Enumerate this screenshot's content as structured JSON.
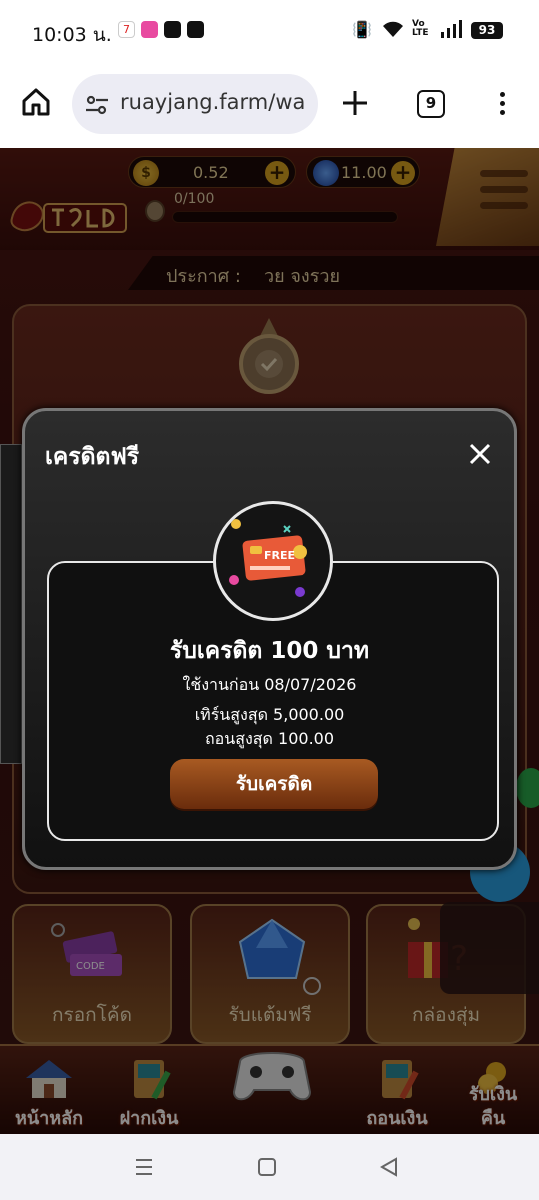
{
  "status_bar": {
    "time": "10:03 น.",
    "battery": "93"
  },
  "browser": {
    "url": "ruayjang.farm/wa",
    "tab_count": "9"
  },
  "game": {
    "coins": "0.52",
    "gems": "11.00",
    "xp": "0/100",
    "announcement_label": "ประกาศ :",
    "announcement_text": "วย จงรวย",
    "tiles": [
      {
        "label": "กรอกโค้ด"
      },
      {
        "label": "รับแต้มฟรี"
      },
      {
        "label": "กล่องสุ่ม"
      }
    ],
    "bottom_nav": [
      {
        "label": "หน้าหลัก"
      },
      {
        "label": "ฝากเงิน"
      },
      {
        "label": "ถอนเงิน"
      },
      {
        "label": "รับเงิน"
      },
      {
        "label": "คืน"
      }
    ]
  },
  "modal": {
    "title": "เครดิตฟรี",
    "badge_text": "FREE",
    "heading": "รับเครดิต 100 บาท",
    "use_before": "ใช้งานก่อน 08/07/2026",
    "max_turnover": "เทิร์นสูงสุด 5,000.00",
    "max_withdraw": "ถอนสูงสุด 100.00",
    "claim_button": "รับเครดิต"
  },
  "colors": {
    "game_background": "#3a100e",
    "modal_background": "#111111",
    "claim_button": "#8a4218",
    "gold": "#d9a21f"
  }
}
